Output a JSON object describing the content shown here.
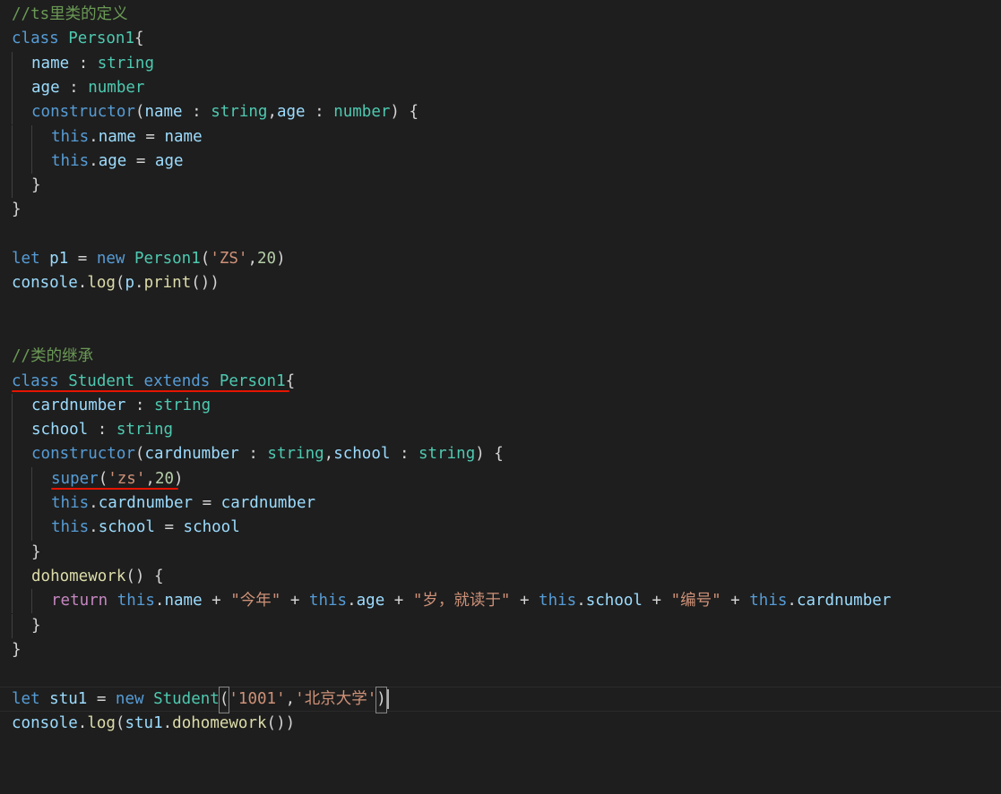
{
  "theme": {
    "background": "#1e1e1e",
    "colors": {
      "comment": "#6a9955",
      "keyword": "#569cd6",
      "control": "#c586c0",
      "type": "#4ec9b0",
      "variable": "#9cdcfe",
      "function": "#dcdcaa",
      "string": "#ce9178",
      "number": "#b5cea8",
      "plain": "#d4d4d4",
      "error_underline": "#e51400"
    }
  },
  "editor": {
    "lines": [
      {
        "indent": 0,
        "tokens": [
          [
            "//ts里类的定义",
            "comment"
          ]
        ]
      },
      {
        "indent": 0,
        "tokens": [
          [
            "class",
            "keyword"
          ],
          [
            " ",
            "plain"
          ],
          [
            "Person1",
            "type"
          ],
          [
            "{",
            "plain"
          ]
        ]
      },
      {
        "indent": 1,
        "tokens": [
          [
            "name",
            "variable"
          ],
          [
            " : ",
            "plain"
          ],
          [
            "string",
            "type"
          ]
        ]
      },
      {
        "indent": 1,
        "tokens": [
          [
            "age",
            "variable"
          ],
          [
            " : ",
            "plain"
          ],
          [
            "number",
            "type"
          ]
        ]
      },
      {
        "indent": 1,
        "tokens": [
          [
            "constructor",
            "keyword"
          ],
          [
            "(",
            "plain"
          ],
          [
            "name",
            "variable"
          ],
          [
            " : ",
            "plain"
          ],
          [
            "string",
            "type"
          ],
          [
            ",",
            "plain"
          ],
          [
            "age",
            "variable"
          ],
          [
            " : ",
            "plain"
          ],
          [
            "number",
            "type"
          ],
          [
            ") {",
            "plain"
          ]
        ]
      },
      {
        "indent": 2,
        "tokens": [
          [
            "this",
            "keyword"
          ],
          [
            ".",
            "plain"
          ],
          [
            "name",
            "variable"
          ],
          [
            " = ",
            "plain"
          ],
          [
            "name",
            "variable"
          ]
        ]
      },
      {
        "indent": 2,
        "tokens": [
          [
            "this",
            "keyword"
          ],
          [
            ".",
            "plain"
          ],
          [
            "age",
            "variable"
          ],
          [
            " = ",
            "plain"
          ],
          [
            "age",
            "variable"
          ]
        ]
      },
      {
        "indent": 1,
        "tokens": [
          [
            "}",
            "plain"
          ]
        ]
      },
      {
        "indent": 0,
        "tokens": [
          [
            "}",
            "plain"
          ]
        ]
      },
      {
        "indent": 0,
        "tokens": []
      },
      {
        "indent": 0,
        "tokens": [
          [
            "let",
            "keyword"
          ],
          [
            " ",
            "plain"
          ],
          [
            "p1",
            "variable"
          ],
          [
            " = ",
            "plain"
          ],
          [
            "new",
            "keyword"
          ],
          [
            " ",
            "plain"
          ],
          [
            "Person1",
            "type"
          ],
          [
            "(",
            "plain"
          ],
          [
            "'ZS'",
            "string"
          ],
          [
            ",",
            "plain"
          ],
          [
            "20",
            "number"
          ],
          [
            ")",
            "plain"
          ]
        ]
      },
      {
        "indent": 0,
        "tokens": [
          [
            "console",
            "variable"
          ],
          [
            ".",
            "plain"
          ],
          [
            "log",
            "function"
          ],
          [
            "(",
            "plain"
          ],
          [
            "p",
            "variable"
          ],
          [
            ".",
            "plain"
          ],
          [
            "print",
            "function"
          ],
          [
            "())",
            "plain"
          ]
        ]
      },
      {
        "indent": 0,
        "tokens": []
      },
      {
        "indent": 0,
        "tokens": []
      },
      {
        "indent": 0,
        "tokens": [
          [
            "//类的继承",
            "comment"
          ]
        ]
      },
      {
        "indent": 0,
        "underline": true,
        "tokens": [
          [
            "class",
            "keyword"
          ],
          [
            " ",
            "plain"
          ],
          [
            "Student",
            "type"
          ],
          [
            " ",
            "plain"
          ],
          [
            "extends",
            "keyword"
          ],
          [
            " ",
            "plain"
          ],
          [
            "Person1",
            "type"
          ],
          [
            "{",
            "plain"
          ]
        ]
      },
      {
        "indent": 1,
        "tokens": [
          [
            "cardnumber",
            "variable"
          ],
          [
            " : ",
            "plain"
          ],
          [
            "string",
            "type"
          ]
        ]
      },
      {
        "indent": 1,
        "tokens": [
          [
            "school",
            "variable"
          ],
          [
            " : ",
            "plain"
          ],
          [
            "string",
            "type"
          ]
        ]
      },
      {
        "indent": 1,
        "tokens": [
          [
            "constructor",
            "keyword"
          ],
          [
            "(",
            "plain"
          ],
          [
            "cardnumber",
            "variable"
          ],
          [
            " : ",
            "plain"
          ],
          [
            "string",
            "type"
          ],
          [
            ",",
            "plain"
          ],
          [
            "school",
            "variable"
          ],
          [
            " : ",
            "plain"
          ],
          [
            "string",
            "type"
          ],
          [
            ") {",
            "plain"
          ]
        ]
      },
      {
        "indent": 2,
        "underline": true,
        "tokens": [
          [
            "super",
            "keyword"
          ],
          [
            "(",
            "plain"
          ],
          [
            "'zs'",
            "string"
          ],
          [
            ",",
            "plain"
          ],
          [
            "20",
            "number"
          ],
          [
            ")",
            "plain"
          ]
        ]
      },
      {
        "indent": 2,
        "tokens": [
          [
            "this",
            "keyword"
          ],
          [
            ".",
            "plain"
          ],
          [
            "cardnumber",
            "variable"
          ],
          [
            " = ",
            "plain"
          ],
          [
            "cardnumber",
            "variable"
          ]
        ]
      },
      {
        "indent": 2,
        "tokens": [
          [
            "this",
            "keyword"
          ],
          [
            ".",
            "plain"
          ],
          [
            "school",
            "variable"
          ],
          [
            " = ",
            "plain"
          ],
          [
            "school",
            "variable"
          ]
        ]
      },
      {
        "indent": 1,
        "tokens": [
          [
            "}",
            "plain"
          ]
        ]
      },
      {
        "indent": 1,
        "tokens": [
          [
            "dohomework",
            "function"
          ],
          [
            "() {",
            "plain"
          ]
        ]
      },
      {
        "indent": 2,
        "tokens": [
          [
            "return",
            "control"
          ],
          [
            " ",
            "plain"
          ],
          [
            "this",
            "keyword"
          ],
          [
            ".",
            "plain"
          ],
          [
            "name",
            "variable"
          ],
          [
            " + ",
            "plain"
          ],
          [
            "\"今年\"",
            "string"
          ],
          [
            " + ",
            "plain"
          ],
          [
            "this",
            "keyword"
          ],
          [
            ".",
            "plain"
          ],
          [
            "age",
            "variable"
          ],
          [
            " + ",
            "plain"
          ],
          [
            "\"岁，就读于\"",
            "string"
          ],
          [
            " + ",
            "plain"
          ],
          [
            "this",
            "keyword"
          ],
          [
            ".",
            "plain"
          ],
          [
            "school",
            "variable"
          ],
          [
            " + ",
            "plain"
          ],
          [
            "\"编号\"",
            "string"
          ],
          [
            " + ",
            "plain"
          ],
          [
            "this",
            "keyword"
          ],
          [
            ".",
            "plain"
          ],
          [
            "cardnumber",
            "variable"
          ]
        ]
      },
      {
        "indent": 1,
        "tokens": [
          [
            "}",
            "plain"
          ]
        ]
      },
      {
        "indent": 0,
        "tokens": [
          [
            "}",
            "plain"
          ]
        ]
      },
      {
        "indent": 0,
        "tokens": []
      },
      {
        "indent": 0,
        "active": true,
        "cursor": true,
        "tokens": [
          [
            "let",
            "keyword"
          ],
          [
            " ",
            "plain"
          ],
          [
            "stu1",
            "variable"
          ],
          [
            " = ",
            "plain"
          ],
          [
            "new",
            "keyword"
          ],
          [
            " ",
            "plain"
          ],
          [
            "Student",
            "type"
          ],
          [
            "(",
            "bracket"
          ],
          [
            "'1001'",
            "string"
          ],
          [
            ",",
            "plain"
          ],
          [
            "'北京大学'",
            "string"
          ],
          [
            ")",
            "bracket"
          ]
        ]
      },
      {
        "indent": 0,
        "tokens": [
          [
            "console",
            "variable"
          ],
          [
            ".",
            "plain"
          ],
          [
            "log",
            "function"
          ],
          [
            "(",
            "plain"
          ],
          [
            "stu1",
            "variable"
          ],
          [
            ".",
            "plain"
          ],
          [
            "dohomework",
            "function"
          ],
          [
            "())",
            "plain"
          ]
        ]
      }
    ]
  }
}
